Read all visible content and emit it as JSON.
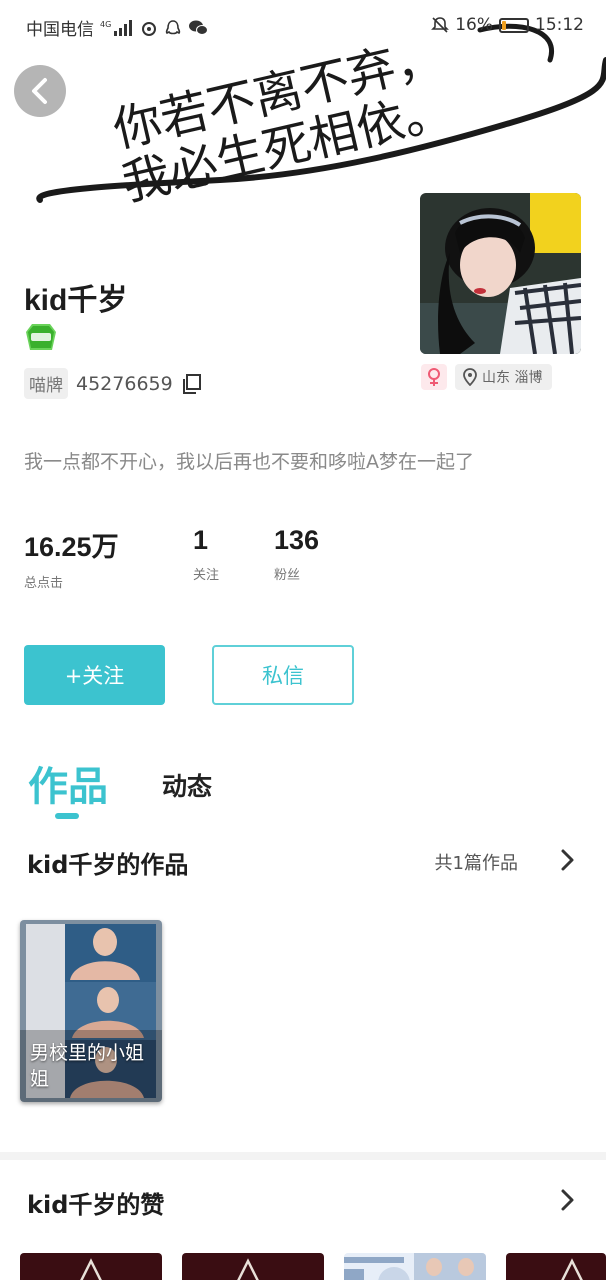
{
  "status_bar": {
    "carrier": "中国电信",
    "network": "4G",
    "battery_text": "16%",
    "time": "15:12"
  },
  "banner": {
    "handwriting_line1": "你若不离不弃，",
    "handwriting_line2": "我必生死相依。"
  },
  "profile": {
    "nickname": "kid千岁",
    "id_label": "喵牌",
    "id_number": "45276659",
    "location": "山东 淄博",
    "signature": "我一点都不开心，我以后再也不要和哆啦A梦在一起了"
  },
  "stats": [
    {
      "value": "16.25万",
      "label": "总点击"
    },
    {
      "value": "1",
      "label": "关注"
    },
    {
      "value": "136",
      "label": "粉丝"
    }
  ],
  "actions": {
    "follow_label": "+关注",
    "message_label": "私信"
  },
  "tabs": {
    "works": "作品",
    "moments": "动态"
  },
  "works_section": {
    "title": "kid千岁的作品",
    "count_text": "共1篇作品",
    "items": [
      {
        "title": "男校里的小姐姐"
      }
    ]
  },
  "likes_section": {
    "title": "kid千岁的赞"
  },
  "colors": {
    "accent": "#3cc3cf",
    "text_primary": "#1d1d1d",
    "text_secondary": "#8a8a8a"
  }
}
